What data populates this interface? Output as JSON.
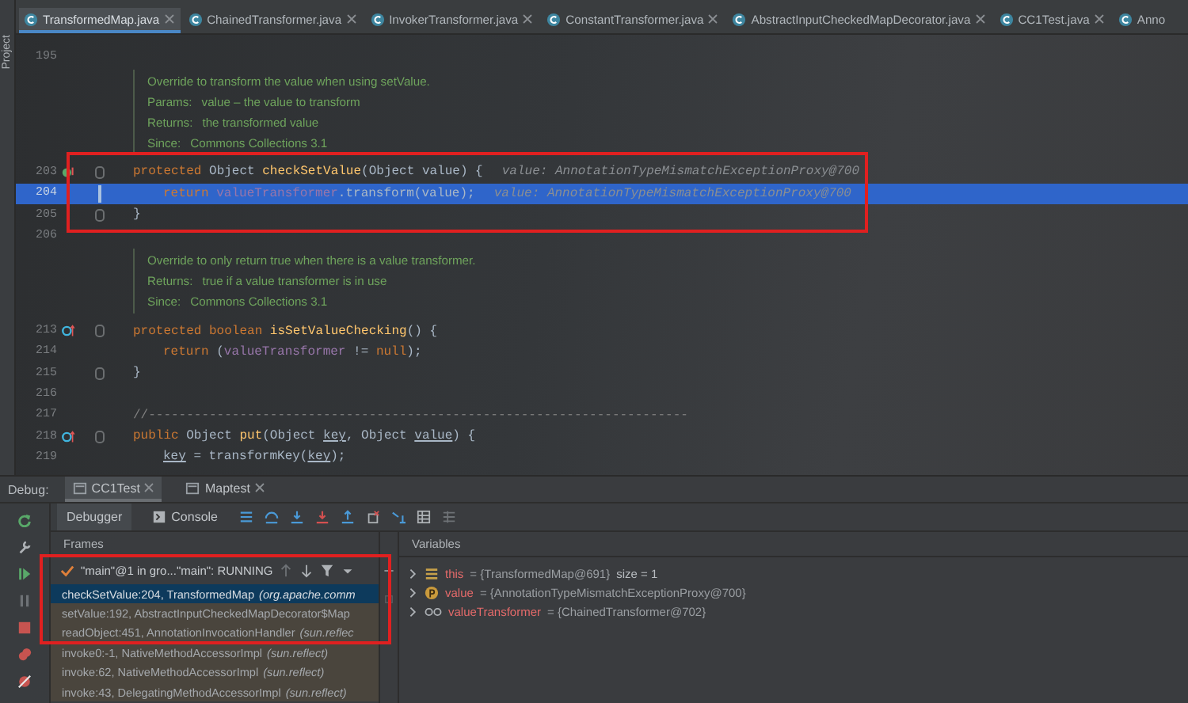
{
  "window": {
    "side_label": "Project"
  },
  "tabs": [
    {
      "label": "TransformedMap.java",
      "selected": true
    },
    {
      "label": "ChainedTransformer.java",
      "selected": false
    },
    {
      "label": "InvokerTransformer.java",
      "selected": false
    },
    {
      "label": "ConstantTransformer.java",
      "selected": false
    },
    {
      "label": "AbstractInputCheckedMapDecorator.java",
      "selected": false
    },
    {
      "label": "CC1Test.java",
      "selected": false
    },
    {
      "label": "Anno",
      "selected": false
    }
  ],
  "editor": {
    "lines": [
      {
        "kind": "code",
        "number": "195",
        "fold": false,
        "current": false
      },
      {
        "kind": "doc",
        "rows": [
          {
            "text": "Override to transform the value when using setValue."
          },
          {
            "label": "Params:",
            "text": "value – the value to transform"
          },
          {
            "label": "Returns:",
            "text": "the transformed value"
          },
          {
            "label": "Since:",
            "text": "Commons Collections 3.1"
          }
        ]
      },
      {
        "kind": "code",
        "number": "203",
        "gutter_icon": {
          "kind": "overrides"
        },
        "fold": true,
        "current": false,
        "indented": false,
        "tokens": [
          {
            "kind": "keyword",
            "text": "protected "
          },
          {
            "kind": "plain",
            "text": "Object "
          },
          {
            "kind": "method",
            "text": "checkSetValue"
          },
          {
            "kind": "plain",
            "text": "(Object value) {"
          }
        ],
        "hint": "value: AnnotationTypeMismatchExceptionProxy@700"
      },
      {
        "kind": "code",
        "number": "204",
        "fold": false,
        "current": true,
        "indented": true,
        "tokens": [
          {
            "kind": "keyword",
            "text": "return "
          },
          {
            "kind": "field",
            "text": "valueTransformer"
          },
          {
            "kind": "plain",
            "text": ".transform(value);"
          }
        ],
        "hint": "value: AnnotationTypeMismatchExceptionProxy@700"
      },
      {
        "kind": "code",
        "number": "205",
        "fold": true,
        "current": false,
        "indented": false,
        "tokens": [
          {
            "kind": "plain",
            "text": "}"
          }
        ]
      },
      {
        "kind": "code",
        "number": "206",
        "fold": false,
        "current": false
      },
      {
        "kind": "doc",
        "rows": [
          {
            "text": "Override to only return true when there is a value transformer."
          },
          {
            "label": "Returns:",
            "text": "true if a value transformer is in use"
          },
          {
            "label": "Since:",
            "text": "Commons Collections 3.1"
          }
        ]
      },
      {
        "kind": "code",
        "number": "213",
        "gutter_icon": {
          "kind": "implements"
        },
        "fold": true,
        "current": false,
        "indented": false,
        "tokens": [
          {
            "kind": "keyword",
            "text": "protected boolean "
          },
          {
            "kind": "method",
            "text": "isSetValueChecking"
          },
          {
            "kind": "plain",
            "text": "() {"
          }
        ]
      },
      {
        "kind": "code",
        "number": "214",
        "fold": false,
        "current": false,
        "indented": true,
        "tokens": [
          {
            "kind": "keyword",
            "text": "return "
          },
          {
            "kind": "plain",
            "text": "("
          },
          {
            "kind": "field",
            "text": "valueTransformer"
          },
          {
            "kind": "plain",
            "text": " != "
          },
          {
            "kind": "keyword",
            "text": "null"
          },
          {
            "kind": "plain",
            "text": ");"
          }
        ]
      },
      {
        "kind": "code",
        "number": "215",
        "fold": true,
        "current": false,
        "indented": false,
        "tokens": [
          {
            "kind": "plain",
            "text": "}"
          }
        ]
      },
      {
        "kind": "code",
        "number": "216",
        "fold": false,
        "current": false
      },
      {
        "kind": "code",
        "number": "217",
        "fold": false,
        "current": false,
        "indented": false,
        "tokens": [
          {
            "kind": "comment",
            "text": "//-----------------------------------------------------------------------"
          }
        ]
      },
      {
        "kind": "code",
        "number": "218",
        "gutter_icon": {
          "kind": "implements"
        },
        "fold": true,
        "current": false,
        "indented": false,
        "tokens": [
          {
            "kind": "keyword",
            "text": "public "
          },
          {
            "kind": "plain",
            "text": "Object "
          },
          {
            "kind": "method",
            "text": "put"
          },
          {
            "kind": "plain",
            "text": "(Object "
          },
          {
            "kind": "param",
            "text": "key"
          },
          {
            "kind": "plain",
            "text": ", Object "
          },
          {
            "kind": "param",
            "text": "value"
          },
          {
            "kind": "plain",
            "text": ") {"
          }
        ]
      },
      {
        "kind": "code",
        "number": "219",
        "fold": false,
        "current": false,
        "indented": true,
        "tokens": [
          {
            "kind": "param",
            "text": "key"
          },
          {
            "kind": "plain",
            "text": " = transformKey("
          },
          {
            "kind": "param",
            "text": "key"
          },
          {
            "kind": "plain",
            "text": ");"
          }
        ]
      }
    ]
  },
  "debug": {
    "label": "Debug:",
    "sessions": [
      {
        "label": "CC1Test",
        "selected": true
      },
      {
        "label": "Maptest",
        "selected": false
      }
    ],
    "views": [
      {
        "label": "Debugger",
        "selected": true
      },
      {
        "label": "Console",
        "selected": false
      }
    ],
    "frames": {
      "title": "Frames",
      "thread": "\"main\"@1 in gro...\"main\": RUNNING",
      "items": [
        {
          "method": "checkSetValue:204, TransformedMap",
          "package": "(org.apache.comm",
          "selected": true
        },
        {
          "method": "setValue:192, AbstractInputCheckedMapDecorator$Map",
          "selected": false
        },
        {
          "method": "readObject:451, AnnotationInvocationHandler",
          "package": "(sun.reflec",
          "selected": false
        },
        {
          "method": "invoke0:-1, NativeMethodAccessorImpl",
          "package": "(sun.reflect)",
          "selected": false
        },
        {
          "method": "invoke:62, NativeMethodAccessorImpl",
          "package": "(sun.reflect)",
          "selected": false
        },
        {
          "method": "invoke:43, DelegatingMethodAccessorImpl",
          "package": "(sun.reflect)",
          "selected": false
        }
      ]
    },
    "variables": {
      "title": "Variables",
      "items": [
        {
          "kind": "object",
          "name": "this",
          "value": "= {TransformedMap@691}",
          "extra": "size = 1"
        },
        {
          "kind": "param",
          "name": "value",
          "value": "= {AnnotationTypeMismatchExceptionProxy@700}"
        },
        {
          "kind": "watch",
          "name": "valueTransformer",
          "value": "= {ChainedTransformer@702}"
        }
      ]
    }
  }
}
